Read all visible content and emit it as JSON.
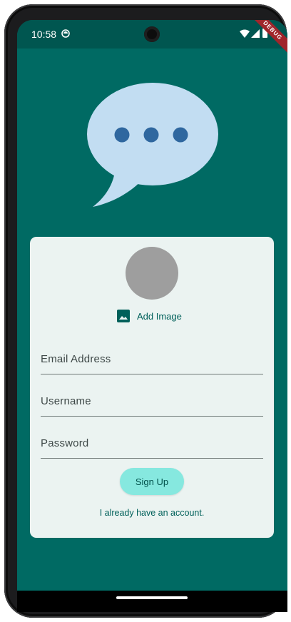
{
  "status_bar": {
    "time": "10:58",
    "debug_label": "DEBUG"
  },
  "colors": {
    "background": "#006a63",
    "status_bar": "#005650",
    "card": "#ebf3f1",
    "accent": "#00605a",
    "button": "#86e8df",
    "avatar_placeholder": "#9e9e9e",
    "bubble": "#c2ddf2",
    "bubble_dots": "#2f679f"
  },
  "logo": {
    "icon": "chat-bubble-icon"
  },
  "form": {
    "avatar_icon": "avatar-placeholder",
    "add_image_icon": "image-icon",
    "add_image_label": "Add Image",
    "email": {
      "value": "",
      "placeholder": "Email Address"
    },
    "username": {
      "value": "",
      "placeholder": "Username"
    },
    "password": {
      "value": "",
      "placeholder": "Password"
    },
    "signup_label": "Sign Up",
    "login_link": "I already have an account."
  }
}
